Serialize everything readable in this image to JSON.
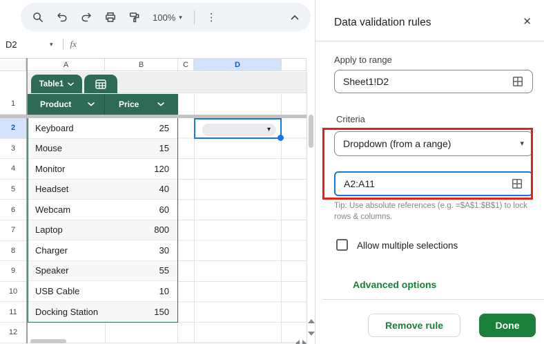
{
  "toolbar": {
    "zoom_value": "100%",
    "icons": [
      "search-icon",
      "undo-icon",
      "redo-icon",
      "print-icon",
      "paint-format-icon",
      "more-vert-icon",
      "collapse-toolbar-icon"
    ]
  },
  "name_box": {
    "value": "D2",
    "fx_label": "fx"
  },
  "sheet": {
    "column_letters": [
      "A",
      "B",
      "C",
      "D"
    ],
    "selected_column": "D",
    "row_numbers": [
      "1",
      "2",
      "3",
      "4",
      "5",
      "6",
      "7",
      "8",
      "9",
      "10",
      "11",
      "12"
    ],
    "selected_row": "2",
    "table": {
      "name": "Table1",
      "headers": [
        "Product",
        "Price"
      ],
      "rows": [
        {
          "product": "Keyboard",
          "price": "25"
        },
        {
          "product": "Mouse",
          "price": "15"
        },
        {
          "product": "Monitor",
          "price": "120"
        },
        {
          "product": "Headset",
          "price": "40"
        },
        {
          "product": "Webcam",
          "price": "60"
        },
        {
          "product": "Laptop",
          "price": "800"
        },
        {
          "product": "Charger",
          "price": "30"
        },
        {
          "product": "Speaker",
          "price": "55"
        },
        {
          "product": "USB Cable",
          "price": "10"
        },
        {
          "product": "Docking Station",
          "price": "150"
        }
      ]
    }
  },
  "panel": {
    "title": "Data validation rules",
    "close_glyph": "✕",
    "apply_to_range_label": "Apply to range",
    "range_value": "Sheet1!D2",
    "criteria_label": "Criteria",
    "criteria_value": "Dropdown (from a range)",
    "criteria_range_value": "A2:A11",
    "tip_text": "Tip: Use absolute references (e.g. =$A$1:$B$1) to lock rows & columns.",
    "checkbox_label": "Allow multiple selections",
    "advanced_options_label": "Advanced options",
    "remove_rule_label": "Remove rule",
    "done_label": "Done"
  },
  "colors": {
    "accent_green": "#188038",
    "table_green": "#2e6b55",
    "selection_blue": "#1a73e8",
    "selected_header_bg": "#d3e3fd",
    "annotation_red": "#e2231a",
    "toolbar_bg": "#f0f4f9"
  }
}
